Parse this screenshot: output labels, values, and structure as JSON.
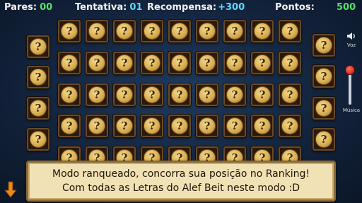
{
  "hud": {
    "pares_label": "Pares:",
    "pares_value": "00",
    "tentativa_label": "Tentativa:",
    "tentativa_value": "01",
    "recompensa_label": "Recompensa:",
    "recompensa_value": "+300",
    "pontos_label": "Pontos:",
    "pontos_value": "500"
  },
  "card_symbol": "?",
  "audio": {
    "voz_label": "Voz",
    "musica_label": "Música"
  },
  "message": {
    "line1": "Modo ranqueado, concorra sua posição no Ranking!",
    "line2": "Com todas as Letras do Alef Beit neste modo :D"
  },
  "icons": {
    "speaker": "speaker-icon",
    "down_arrow": "down-arrow-icon"
  },
  "colors": {
    "accent_green": "#58e06a",
    "accent_cyan": "#5fd9ff",
    "card_gold": "#d6ab4f",
    "panel_bg": "#f1e2b6",
    "arrow_orange": "#e88a1c"
  }
}
